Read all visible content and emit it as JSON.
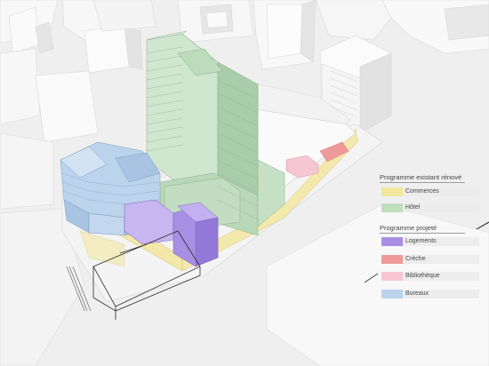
{
  "legend": {
    "existing_title": "Programme existant rénové",
    "existing": [
      {
        "label": "Commerces",
        "color": "#f3e79b"
      },
      {
        "label": "Hôtel",
        "color": "#bfdfbf"
      }
    ],
    "projected_title": "Programme projeté",
    "projected": [
      {
        "label": "Logements",
        "color": "#a98fe3"
      },
      {
        "label": "Crèche",
        "color": "#ef9a9a"
      },
      {
        "label": "Bibliothèque",
        "color": "#f6c6d3"
      },
      {
        "label": "Bureaux",
        "color": "#bcd3ec"
      }
    ]
  }
}
